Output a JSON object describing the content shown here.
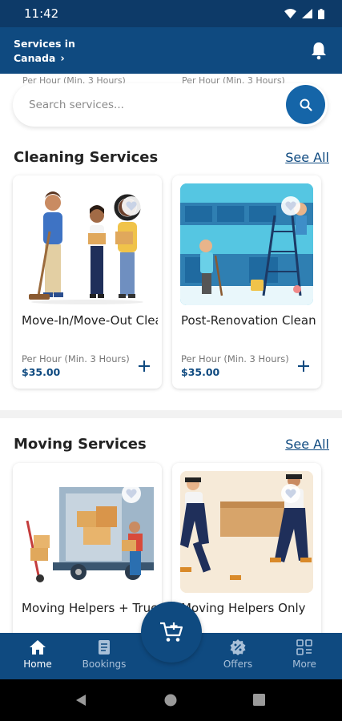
{
  "status_bar": {
    "time": "11:42"
  },
  "header": {
    "location_line1": "Services in",
    "location_line2": "Canada"
  },
  "peek_text": "Per Hour (Min. 3 Hours)",
  "search": {
    "placeholder": "Search services..."
  },
  "sections": [
    {
      "title": "Cleaning Services",
      "see_all": "See All",
      "cards": [
        {
          "name": "Move-In/Move-Out Cleaning",
          "unit": "Per Hour (Min. 3 Hours)",
          "price": "$35.00"
        },
        {
          "name": "Post-Renovation Cleaning",
          "unit": "Per Hour (Min. 3 Hours)",
          "price": "$35.00"
        }
      ]
    },
    {
      "title": "Moving Services",
      "see_all": "See All",
      "cards": [
        {
          "name": "Moving Helpers + Truck"
        },
        {
          "name": "Moving Helpers Only"
        }
      ]
    }
  ],
  "bottom_nav": [
    {
      "label": "Home",
      "icon": "home-icon",
      "active": true
    },
    {
      "label": "Bookings",
      "icon": "bookings-icon"
    },
    {
      "label": "Offers",
      "icon": "offers-icon"
    },
    {
      "label": "More",
      "icon": "more-grid-icon"
    }
  ],
  "colors": {
    "primary": "#0f4a80",
    "accent": "#1565a8"
  }
}
